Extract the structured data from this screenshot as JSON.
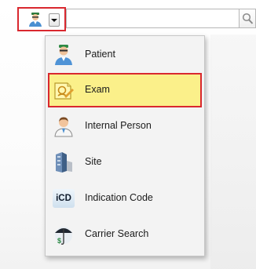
{
  "toolbar": {
    "selected_type_icon": "doctor-person-icon",
    "dropdown_icon": "chevron-down-icon",
    "search": {
      "value": "",
      "placeholder": "",
      "button_icon": "search-icon"
    }
  },
  "menu": {
    "items": [
      {
        "label": "Patient",
        "icon": "patient-icon",
        "highlighted": false
      },
      {
        "label": "Exam",
        "icon": "exam-icon",
        "highlighted": true
      },
      {
        "label": "Internal Person",
        "icon": "internal-person-icon",
        "highlighted": false
      },
      {
        "label": "Site",
        "icon": "site-icon",
        "highlighted": false
      },
      {
        "label": "Indication Code",
        "icon": "icd-icon",
        "icon_text": "iCD",
        "highlighted": false
      },
      {
        "label": "Carrier Search",
        "icon": "carrier-search-icon",
        "highlighted": false
      }
    ]
  },
  "colors": {
    "highlight_fill": "#fbf08a",
    "annotation_border": "#d9282f",
    "menu_background": "#f3f3f3"
  }
}
